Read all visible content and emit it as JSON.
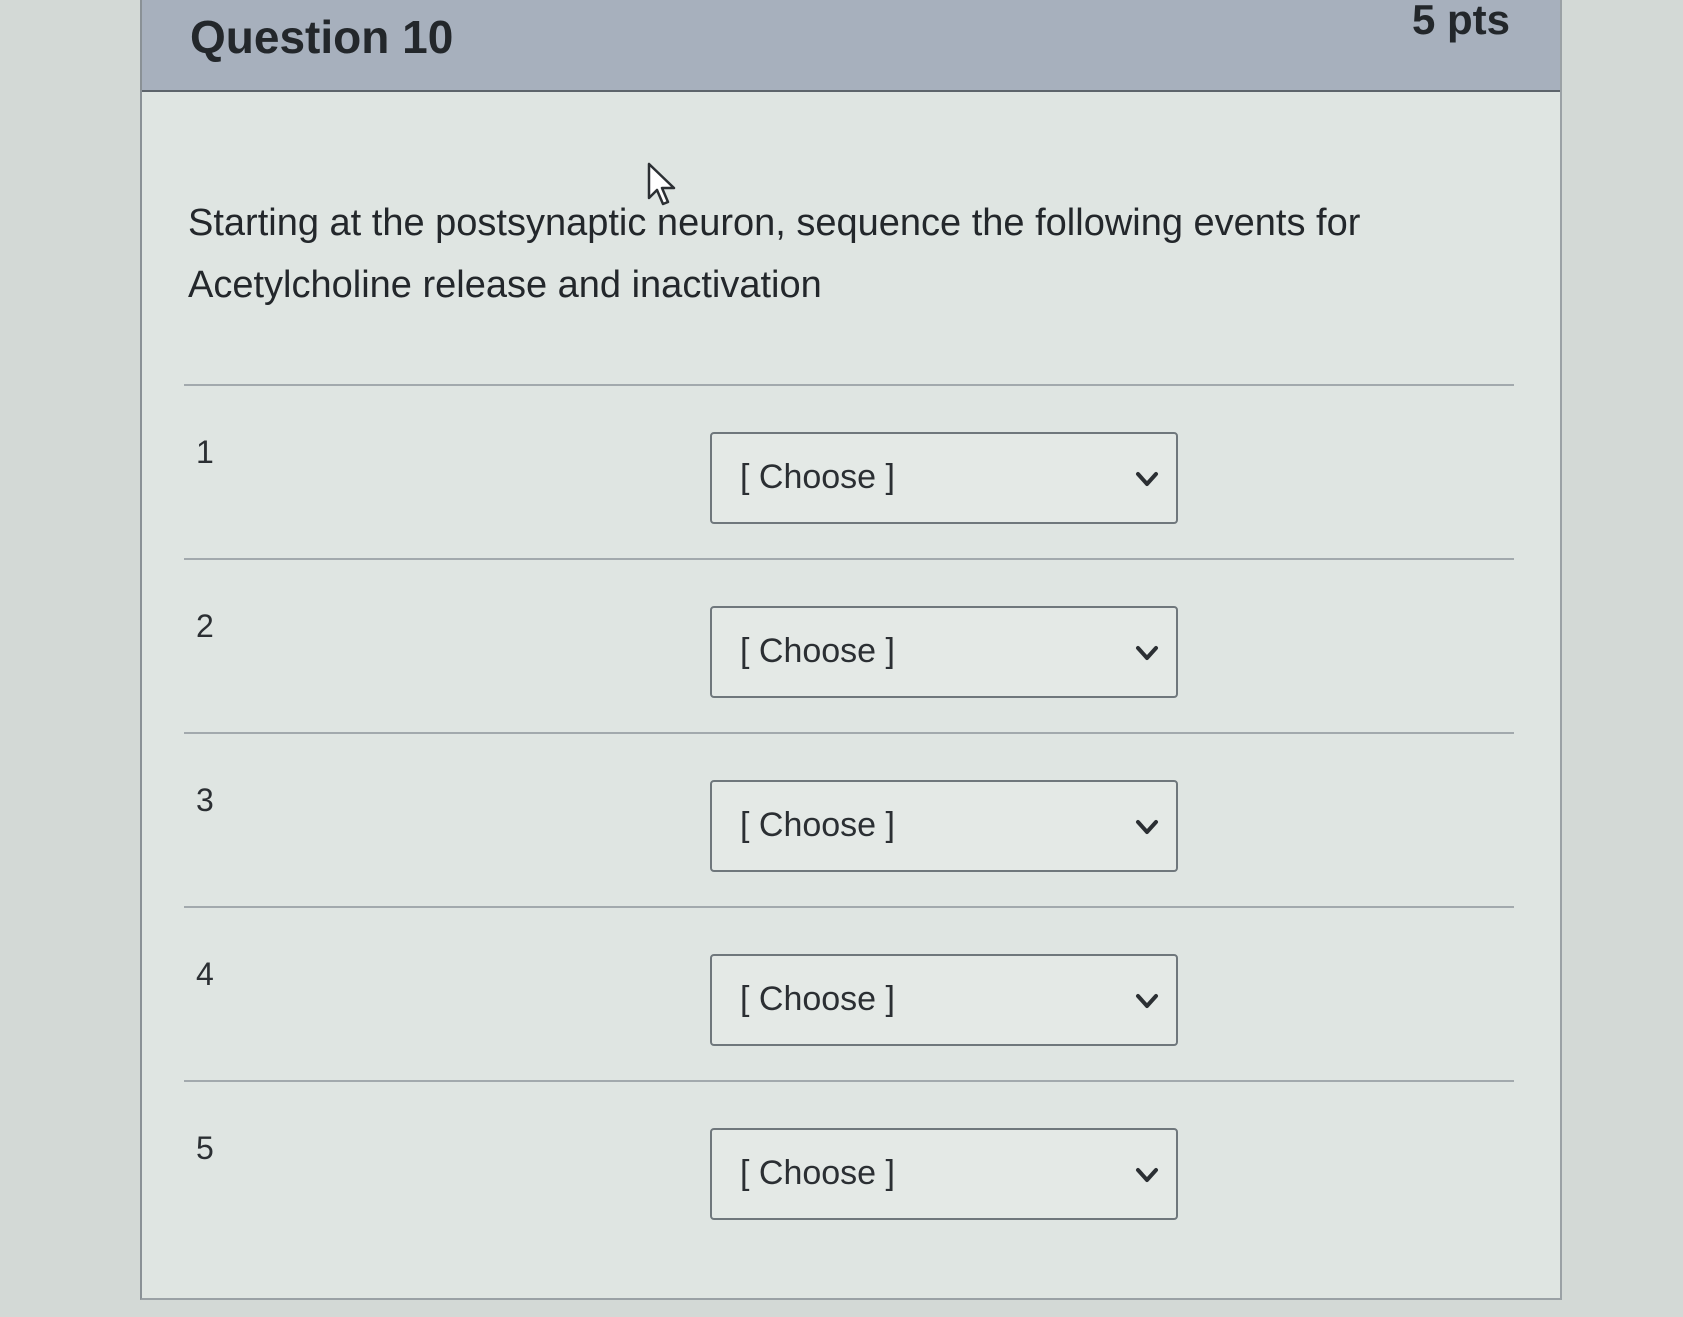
{
  "question": {
    "title": "Question 10",
    "points": "5 pts",
    "text": "Starting at the postsynaptic neuron, sequence the following events for Acetylcholine release and inactivation"
  },
  "answers": [
    {
      "number": "1",
      "selected": "[ Choose ]"
    },
    {
      "number": "2",
      "selected": "[ Choose ]"
    },
    {
      "number": "3",
      "selected": "[ Choose ]"
    },
    {
      "number": "4",
      "selected": "[ Choose ]"
    },
    {
      "number": "5",
      "selected": "[ Choose ]"
    }
  ],
  "icons": {
    "cursor": "mouse-pointer-icon",
    "dropdown": "chevron-down-icon"
  },
  "colors": {
    "header_bg": "#a7b0bd",
    "page_bg": "#dfe5e2"
  }
}
